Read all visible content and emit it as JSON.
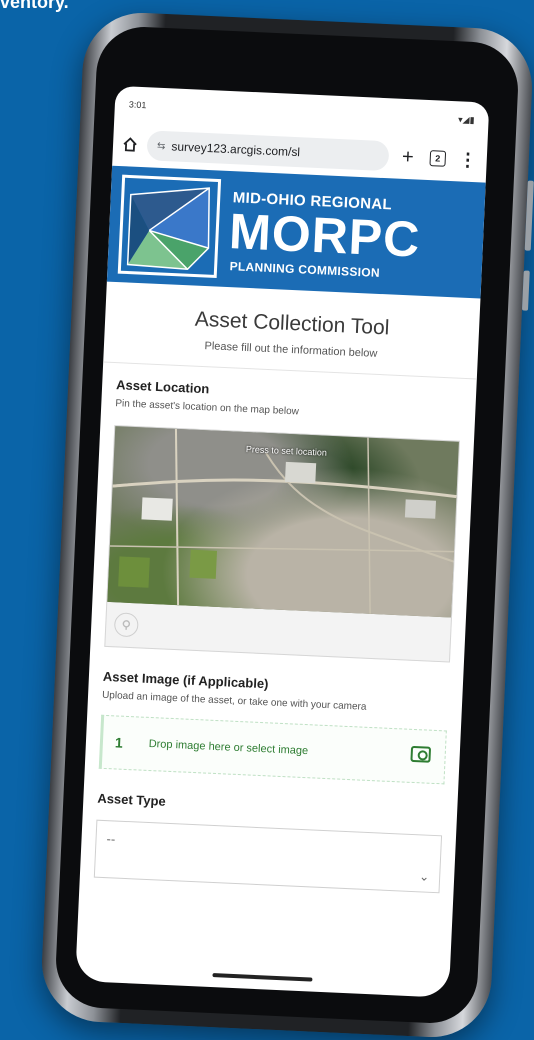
{
  "caption": "ventory.",
  "status_bar": {
    "time": "3:01",
    "icons": "▾◢▮"
  },
  "browser": {
    "url": "survey123.arcgis.com/sl",
    "new_tab": "+",
    "tab_count": "2",
    "menu": "⋮"
  },
  "banner": {
    "line1": "MID-OHIO REGIONAL",
    "line2": "MORPC",
    "line3": "PLANNING COMMISSION",
    "colors": {
      "background": "#1b6cb5",
      "logo_green": "#7dc38f",
      "logo_blue": "#3a78c9"
    }
  },
  "form": {
    "title": "Asset Collection Tool",
    "subtitle": "Please fill out the information below"
  },
  "asset_location": {
    "label": "Asset Location",
    "hint": "Pin the asset's location on the map below",
    "map_tip": "Press to set location"
  },
  "asset_image": {
    "label": "Asset Image (if Applicable)",
    "hint": "Upload an image of the asset, or take one with your camera",
    "upload_number": "1",
    "upload_text": "Drop image here or select image"
  },
  "asset_type": {
    "label": "Asset Type",
    "value": "--"
  }
}
